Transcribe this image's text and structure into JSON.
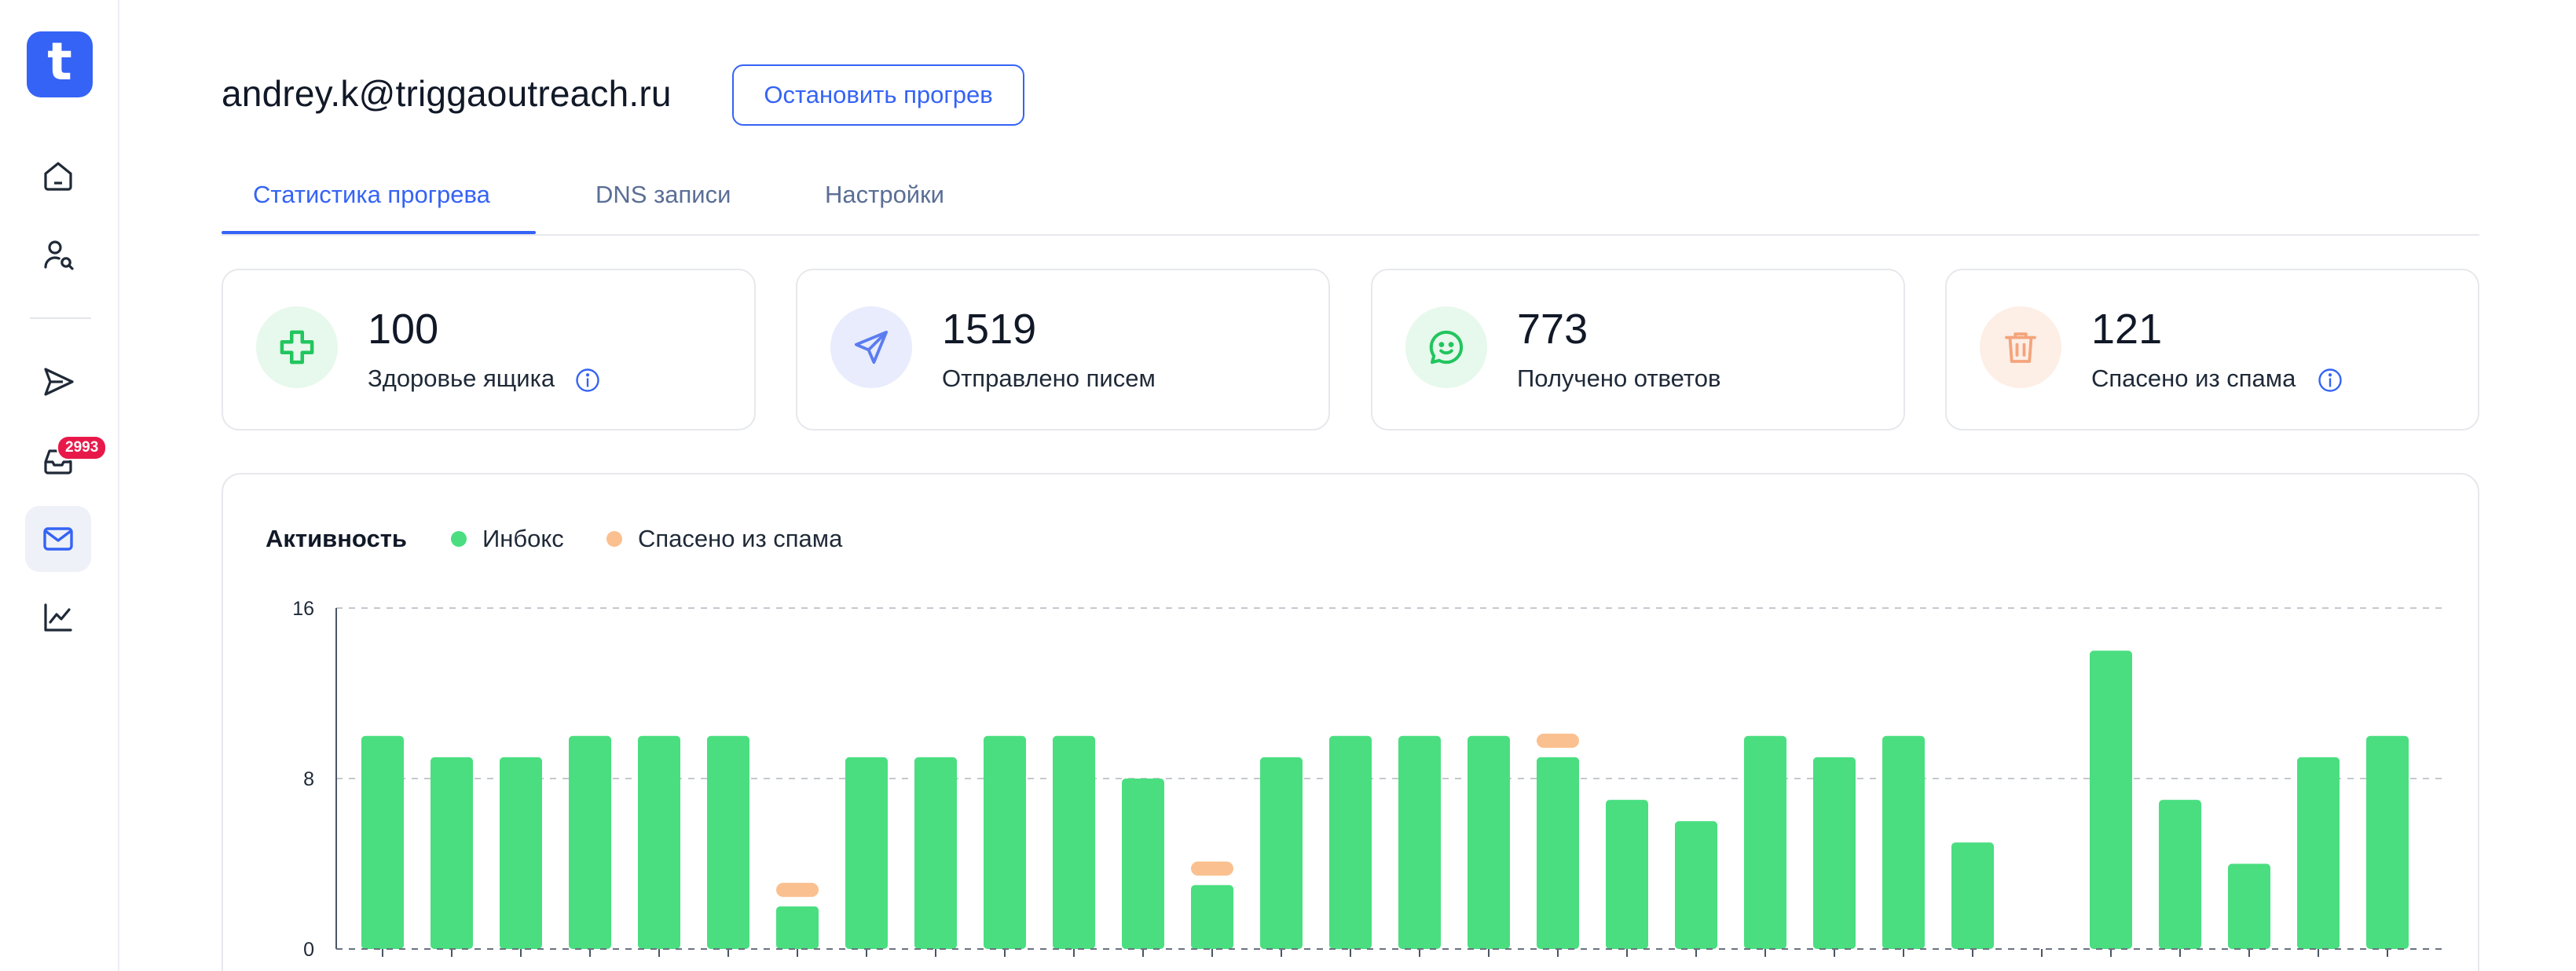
{
  "app": {
    "logo_letter": "t"
  },
  "sidebar": {
    "items": [
      {
        "name": "home",
        "active": false
      },
      {
        "name": "contacts",
        "active": false
      },
      {
        "name": "campaigns",
        "active": false
      },
      {
        "name": "inbox",
        "active": false,
        "badge": "2993"
      },
      {
        "name": "mailboxes",
        "active": true
      },
      {
        "name": "analytics",
        "active": false
      }
    ]
  },
  "header": {
    "email": "andrey.k@triggaoutreach.ru",
    "stop_button": "Остановить прогрев"
  },
  "tabs": [
    {
      "label": "Статистика прогрева",
      "active": true
    },
    {
      "label": "DNS записи",
      "active": false
    },
    {
      "label": "Настройки",
      "active": false
    }
  ],
  "stats": [
    {
      "value": "100",
      "label": "Здоровье ящика",
      "icon": "plus-icon",
      "info": true,
      "color": "#22c55e",
      "bg": "#e7f8ec"
    },
    {
      "value": "1519",
      "label": "Отправлено писем",
      "icon": "send-icon",
      "info": false,
      "color": "#5b7cf0",
      "bg": "#e8ecfc"
    },
    {
      "value": "773",
      "label": "Получено ответов",
      "icon": "chat-icon",
      "info": false,
      "color": "#22c55e",
      "bg": "#e7f8ec"
    },
    {
      "value": "121",
      "label": "Спасено из спама",
      "icon": "trash-icon",
      "info": true,
      "color": "#f4a47c",
      "bg": "#fdeee6"
    }
  ],
  "activity": {
    "title": "Активность",
    "legend": [
      {
        "label": "Инбокс",
        "color": "#4ade80"
      },
      {
        "label": "Спасено из спама",
        "color": "#fbc08f"
      }
    ]
  },
  "chart_data": {
    "type": "bar",
    "title": "Активность",
    "y_ticks": [
      "0",
      "8",
      "16"
    ],
    "ylim": [
      0,
      16
    ],
    "grid": true,
    "legend_position": "top-left",
    "series": [
      {
        "name": "Инбокс",
        "color": "#4ade80",
        "values": [
          10,
          9,
          9,
          10,
          10,
          10,
          2,
          9,
          9,
          10,
          10,
          8,
          3,
          9,
          10,
          10,
          10,
          9,
          7,
          6,
          10,
          9,
          10,
          5,
          0,
          14,
          7,
          4,
          9,
          10
        ]
      },
      {
        "name": "Спасено из спама",
        "color": "#fbc08f",
        "values": [
          0,
          0,
          0,
          0,
          0,
          0,
          1,
          0,
          0,
          0,
          0,
          0,
          1,
          0,
          0,
          0,
          0,
          1,
          0,
          0,
          0,
          0,
          0,
          0,
          0,
          0,
          0,
          0,
          0,
          0
        ]
      }
    ]
  }
}
